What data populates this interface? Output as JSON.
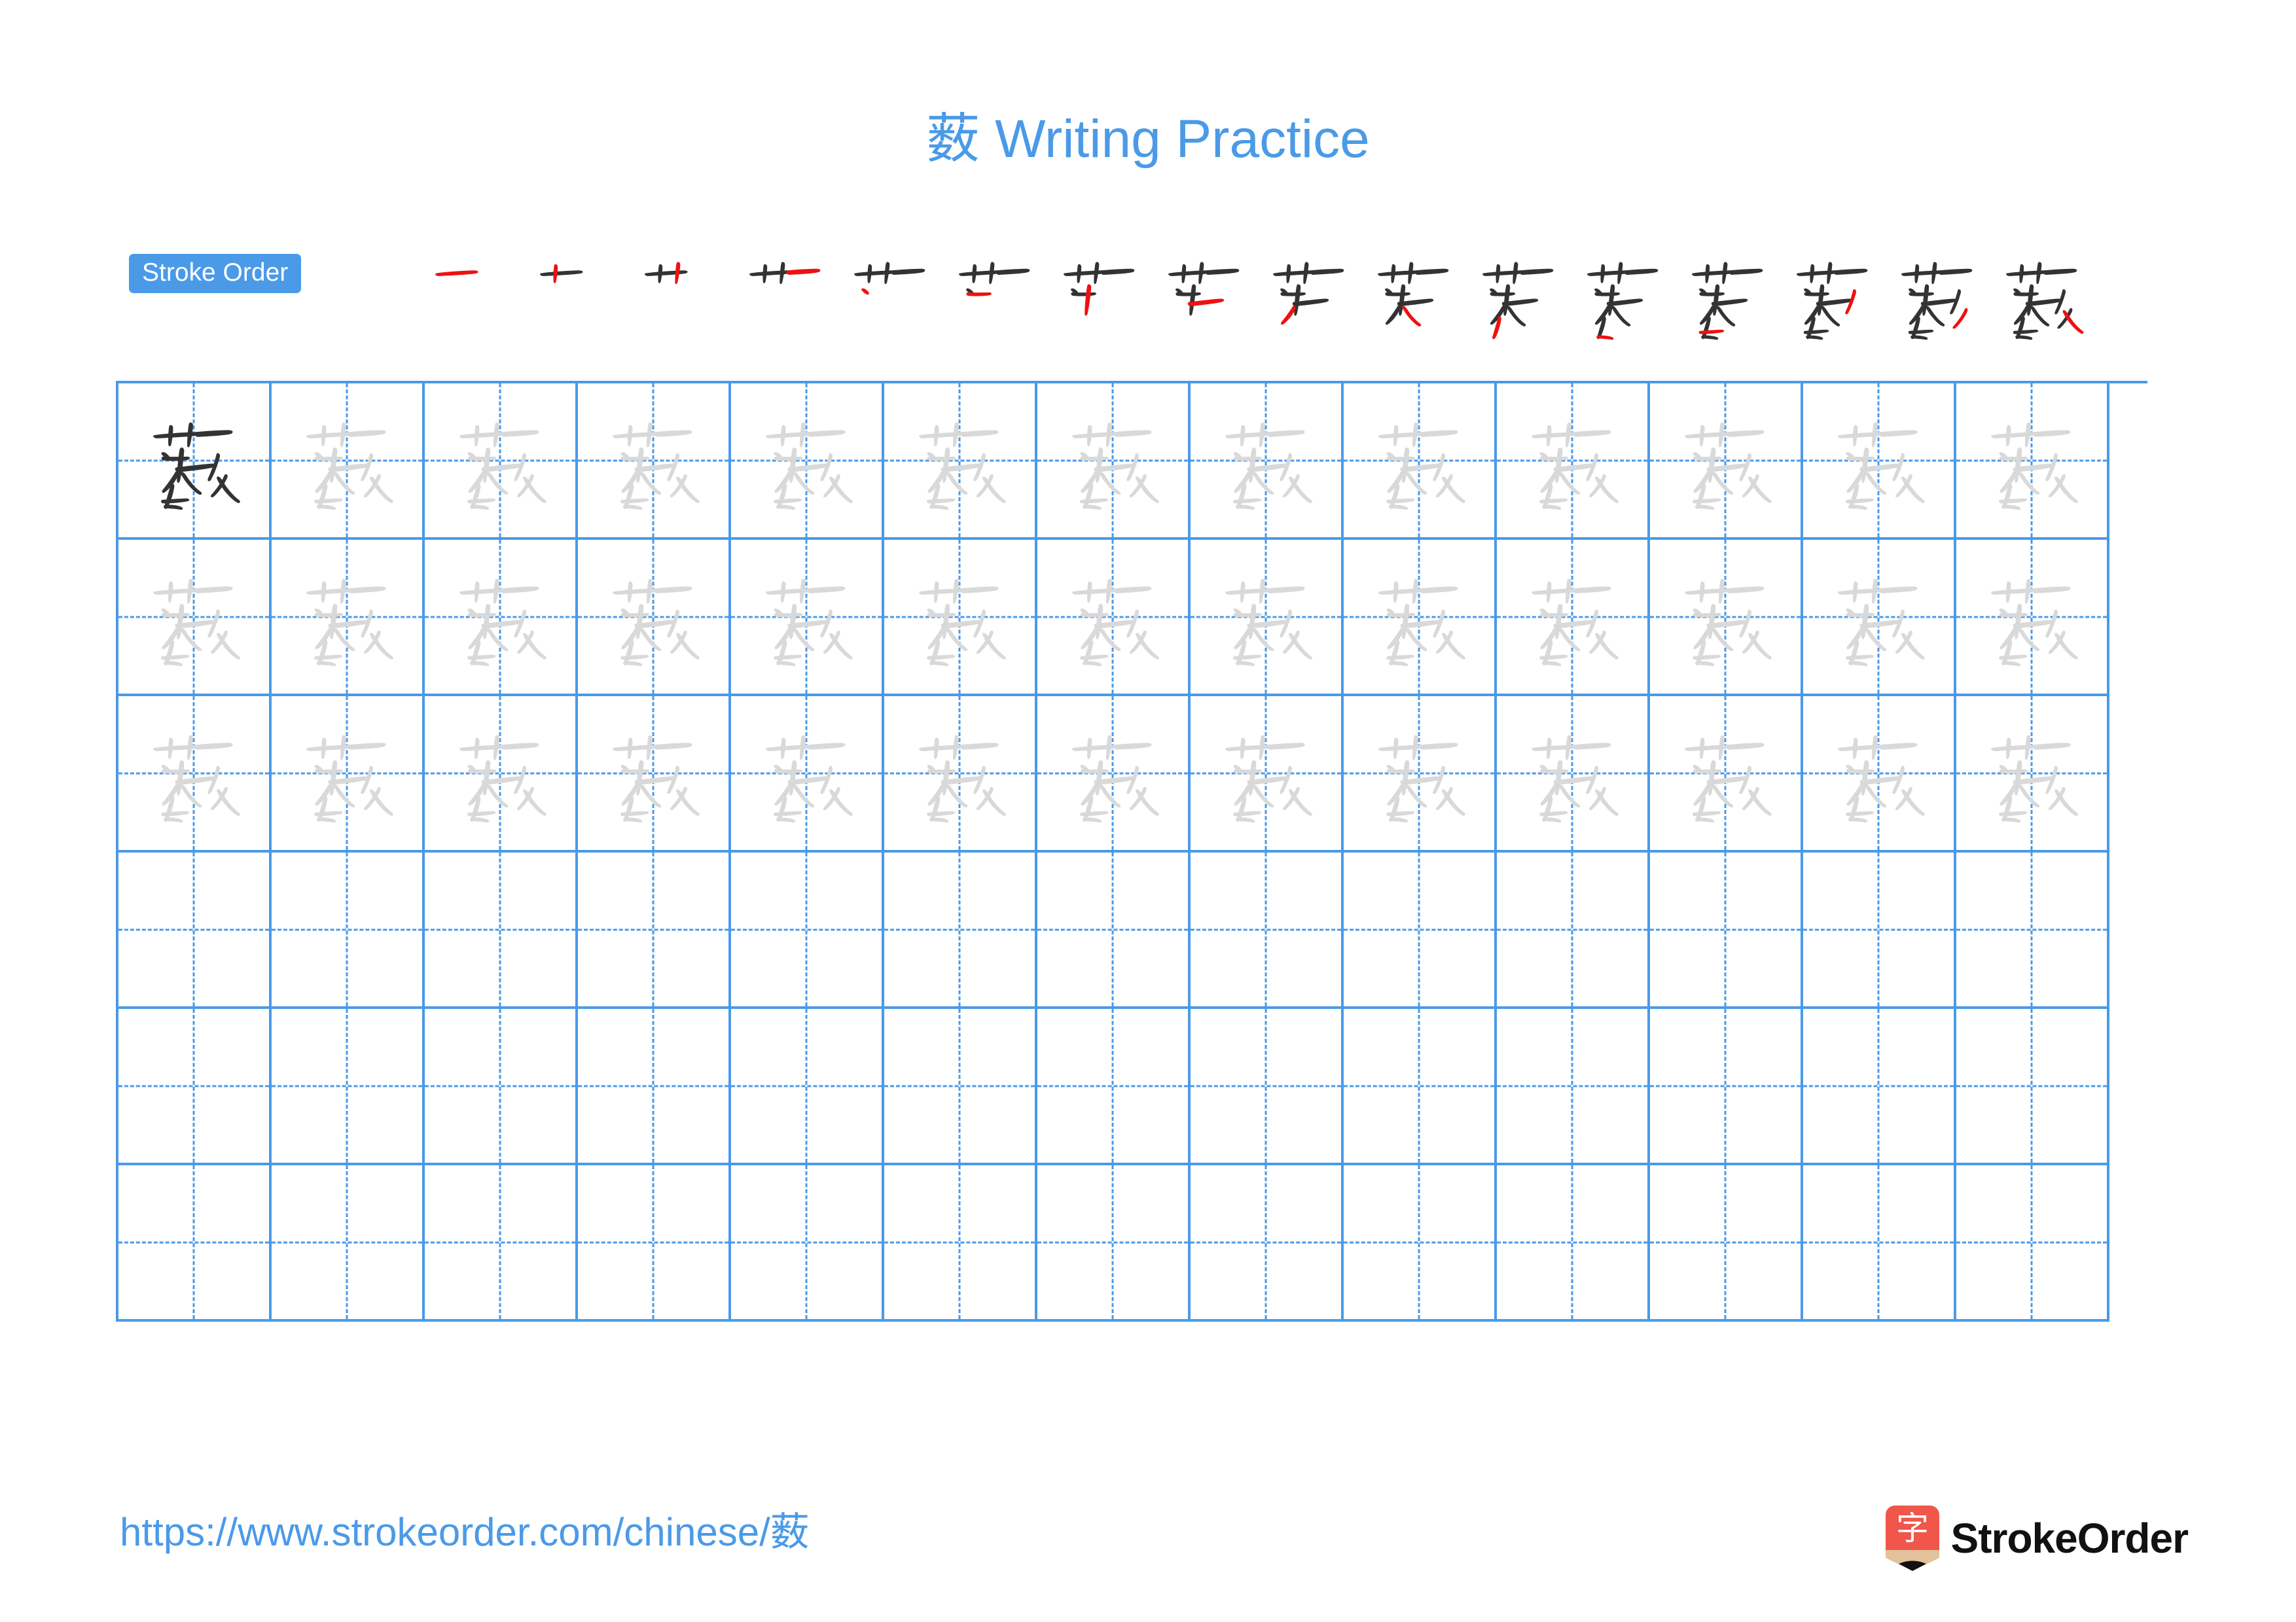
{
  "character": "薮",
  "page": {
    "title": "薮 Writing Practice",
    "title_color": "#4a9ae8",
    "background": "#ffffff"
  },
  "stroke_order": {
    "badge_label": "Stroke Order",
    "badge_bg": "#4a9ae8",
    "badge_text_color": "#ffffff",
    "total_strokes": 16,
    "new_stroke_color": "#ee1111",
    "prior_stroke_color": "#333333",
    "steps": [
      {
        "index": 1,
        "glyph": "一"
      },
      {
        "index": 2,
        "glyph": "十"
      },
      {
        "index": 3,
        "glyph": "卝"
      },
      {
        "index": 4,
        "glyph": "艹"
      },
      {
        "index": 5,
        "glyph": "艹"
      },
      {
        "index": 6,
        "glyph": "艹"
      },
      {
        "index": 7,
        "glyph": "芈"
      },
      {
        "index": 8,
        "glyph": "芈"
      },
      {
        "index": 9,
        "glyph": "苿"
      },
      {
        "index": 10,
        "glyph": "芺"
      },
      {
        "index": 11,
        "glyph": "薮"
      },
      {
        "index": 12,
        "glyph": "薮"
      },
      {
        "index": 13,
        "glyph": "薮"
      },
      {
        "index": 14,
        "glyph": "薮"
      },
      {
        "index": 15,
        "glyph": "薮"
      },
      {
        "index": 16,
        "glyph": "薮"
      }
    ]
  },
  "grid": {
    "columns": 13,
    "rows": 6,
    "line_color": "#4a9ae8",
    "guide_color": "#4a9ae8",
    "model_char_color": "#333333",
    "trace_char_color": "#d9d9d9",
    "row_types": [
      "model-then-trace",
      "trace",
      "trace",
      "blank",
      "blank",
      "blank"
    ]
  },
  "footer": {
    "url": "https://www.strokeorder.com/chinese/薮",
    "url_color": "#4a9ae8",
    "brand_name": "StrokeOrder",
    "brand_char": "字",
    "brand_color": "#f0564a",
    "brand_wood_color": "#e3c19a"
  }
}
